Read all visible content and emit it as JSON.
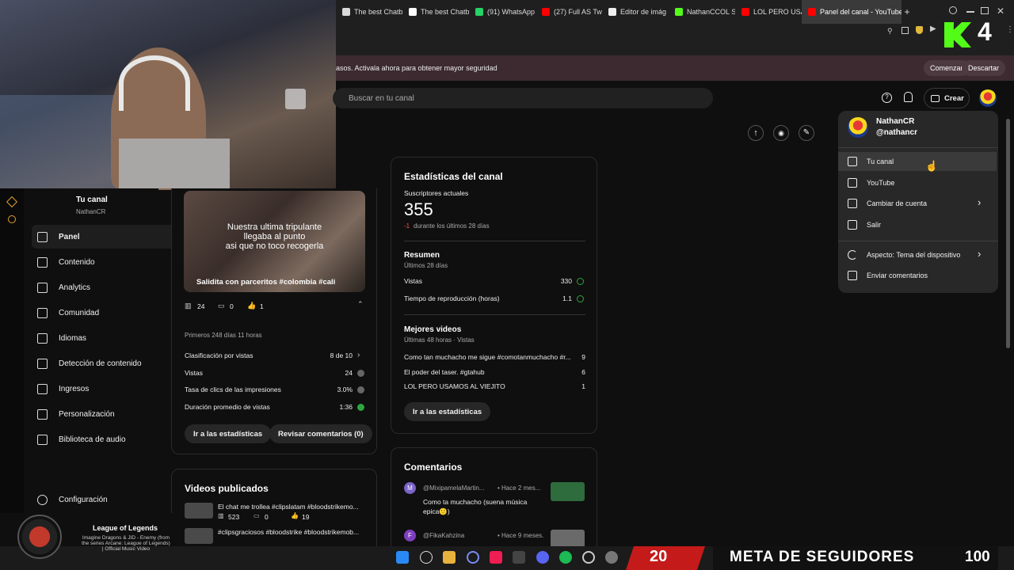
{
  "browser": {
    "tabs": [
      {
        "label": "The best Chatb",
        "color": "#d9d9d9"
      },
      {
        "label": "The best Chatb",
        "color": "#ffffff"
      },
      {
        "label": "(91) WhatsApp",
        "color": "#25d366"
      },
      {
        "label": "(27) Full AS Tw",
        "color": "#ff0000"
      },
      {
        "label": "Editor de imág",
        "color": "#eeeeee"
      },
      {
        "label": "NathanCCOL S",
        "color": "#53fc18"
      },
      {
        "label": "LOL PERO USA",
        "color": "#ff0000"
      },
      {
        "label": "Panel del canal - YouTube",
        "color": "#ff0000"
      }
    ],
    "new_tab": "+"
  },
  "overlay": {
    "counter": "4"
  },
  "banner": {
    "text": "asos. Activala ahora para obtener mayor seguridad",
    "start": "Comenzar",
    "dismiss": "Descartar"
  },
  "header": {
    "search_placeholder": "Buscar en tu canal",
    "create_label": "Crear"
  },
  "sidebar": {
    "channel_title": "Tu canal",
    "channel_handle": "NathanCR",
    "items": [
      {
        "label": "Panel",
        "icon": "dashboard-icon"
      },
      {
        "label": "Contenido",
        "icon": "content-icon"
      },
      {
        "label": "Analytics",
        "icon": "analytics-icon"
      },
      {
        "label": "Comunidad",
        "icon": "community-icon"
      },
      {
        "label": "Idiomas",
        "icon": "subtitles-icon"
      },
      {
        "label": "Detección de contenido",
        "icon": "copyright-icon"
      },
      {
        "label": "Ingresos",
        "icon": "money-icon"
      },
      {
        "label": "Personalización",
        "icon": "brush-icon"
      },
      {
        "label": "Biblioteca de audio",
        "icon": "audio-library-icon"
      }
    ],
    "settings": "Configuración"
  },
  "latest_video": {
    "overlay_lines": [
      "Nuestra ultima tripulante",
      "llegaba al punto",
      "asi que no toco recogerla"
    ],
    "title": "Salidita con parceritos #colombia #cali",
    "views": "24",
    "comments": "0",
    "likes": "1",
    "period": "Primeros 248 días 11 horas",
    "stats": [
      {
        "label": "Clasificación por vistas",
        "value": "8 de 10"
      },
      {
        "label": "Vistas",
        "value": "24"
      },
      {
        "label": "Tasa de clics de las impresiones",
        "value": "3.0%"
      },
      {
        "label": "Duración promedio de vistas",
        "value": "1:36"
      }
    ],
    "btn_stats": "Ir a las estadísticas",
    "btn_comments": "Revisar comentarios (0)"
  },
  "published": {
    "title": "Videos publicados",
    "items": [
      {
        "title": "El chat me trollea #clipslatam #bloodstrikemo...",
        "views": "523",
        "comments": "0",
        "likes": "19"
      },
      {
        "title": "#clipsgraciosos #bloodstrike #bloodstrikemob...",
        "views": "",
        "comments": "",
        "likes": ""
      }
    ]
  },
  "channel_stats": {
    "title": "Estadísticas del canal",
    "subs_label": "Suscriptores actuales",
    "subs": "355",
    "subs_delta": "-1",
    "subs_delta_text": "durante los últimos 28 días",
    "summary_title": "Resumen",
    "summary_period": "Últimos 28 días",
    "summary": [
      {
        "label": "Vistas",
        "value": "330"
      },
      {
        "label": "Tiempo de reproducción (horas)",
        "value": "1.1"
      }
    ],
    "top_title": "Mejores videos",
    "top_period": "Últimas 48 horas · Vistas",
    "top": [
      {
        "title": "Como tan muchacho me sigue #comotanmuchacho #r...",
        "value": "9"
      },
      {
        "title": "El poder del taser. #gtahub",
        "value": "6"
      },
      {
        "title": "LOL PERO USAMOS AL VIEJITO",
        "value": "1"
      }
    ],
    "btn": "Ir a las estadísticas"
  },
  "comments": {
    "title": "Comentarios",
    "items": [
      {
        "initial": "M",
        "author": "@MixipamelaMartin...",
        "time": "• Hace 2 mes...",
        "text": "Como ta muchacho (suena música epica🙂)",
        "color": "#7b63c9"
      },
      {
        "initial": "F",
        "author": "@FikaKahzina",
        "time": "• Hace 9 meses.",
        "text": "",
        "color": "#7e3fbf"
      }
    ]
  },
  "account_menu": {
    "name": "NathanCR",
    "handle": "@nathancr",
    "items": [
      {
        "label": "Tu canal",
        "icon": "account-box-icon"
      },
      {
        "label": "YouTube",
        "icon": "youtube-icon"
      },
      {
        "label": "Cambiar de cuenta",
        "icon": "switch-account-icon"
      },
      {
        "label": "Salir",
        "icon": "sign-out-icon"
      },
      {
        "label": "Aspecto: Tema del dispositivo",
        "icon": "moon-icon"
      },
      {
        "label": "Enviar comentarios",
        "icon": "feedback-icon"
      }
    ]
  },
  "now_playing": {
    "title": "League of Legends",
    "lines": [
      "Imagine Dragons & JID - Enemy (from",
      "the series Arcane: League of Legends)",
      "| Official Music Video"
    ]
  },
  "stream_overlay": {
    "count": "20",
    "goal": "META DE SEGUIDORES",
    "target": "100"
  }
}
